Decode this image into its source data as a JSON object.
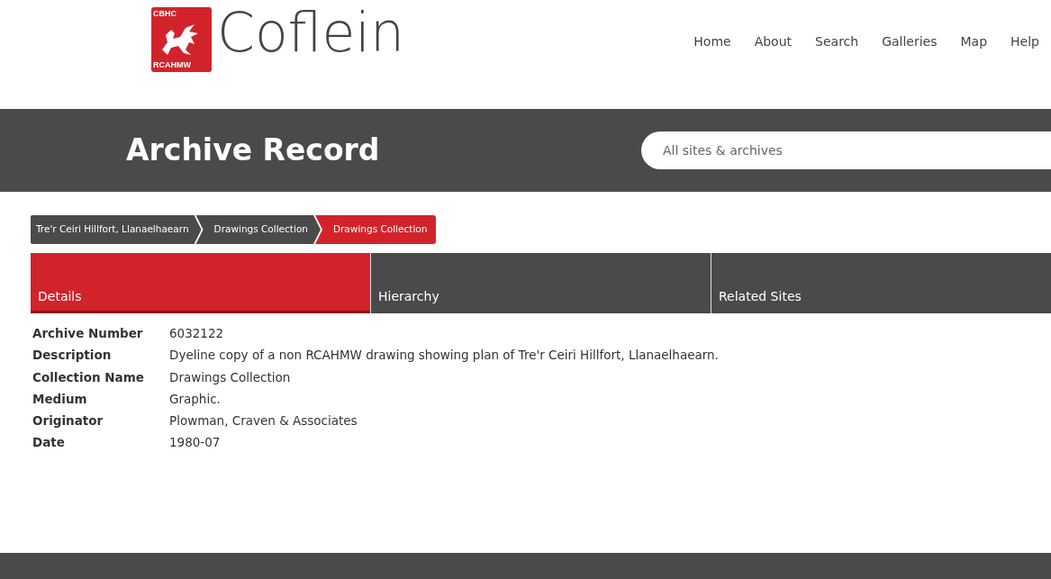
{
  "logo": {
    "badge_top": "CBHC",
    "badge_bottom": "RCAHMW",
    "wordmark": "Coflein"
  },
  "nav": [
    {
      "label": "Home"
    },
    {
      "label": "About"
    },
    {
      "label": "Search"
    },
    {
      "label": "Galleries"
    },
    {
      "label": "Map"
    },
    {
      "label": "Help"
    }
  ],
  "banner": {
    "title": "Archive Record",
    "search": {
      "placeholder": "All sites & archives"
    }
  },
  "breadcrumbs": [
    {
      "label": "Tre'r Ceiri Hillfort, Llanaelhaearn",
      "selected": false
    },
    {
      "label": "Drawings Collection",
      "selected": false
    },
    {
      "label": "Drawings Collection",
      "selected": true
    }
  ],
  "tabs": [
    {
      "label": "Details",
      "selected": true
    },
    {
      "label": "Hierarchy",
      "selected": false
    },
    {
      "label": "Related Sites",
      "selected": false
    }
  ],
  "details": [
    {
      "label": "Archive Number",
      "value": "6032122"
    },
    {
      "label": "Description",
      "value": "Dyeline copy of a non RCAHMW drawing showing plan of Tre'r Ceiri Hillfort, Llanaelhaearn."
    },
    {
      "label": "Collection Name",
      "value": "Drawings Collection"
    },
    {
      "label": "Medium",
      "value": "Graphic."
    },
    {
      "label": "Originator",
      "value": "Plowman, Craven & Associates"
    },
    {
      "label": "Date",
      "value": "1980-07"
    }
  ]
}
